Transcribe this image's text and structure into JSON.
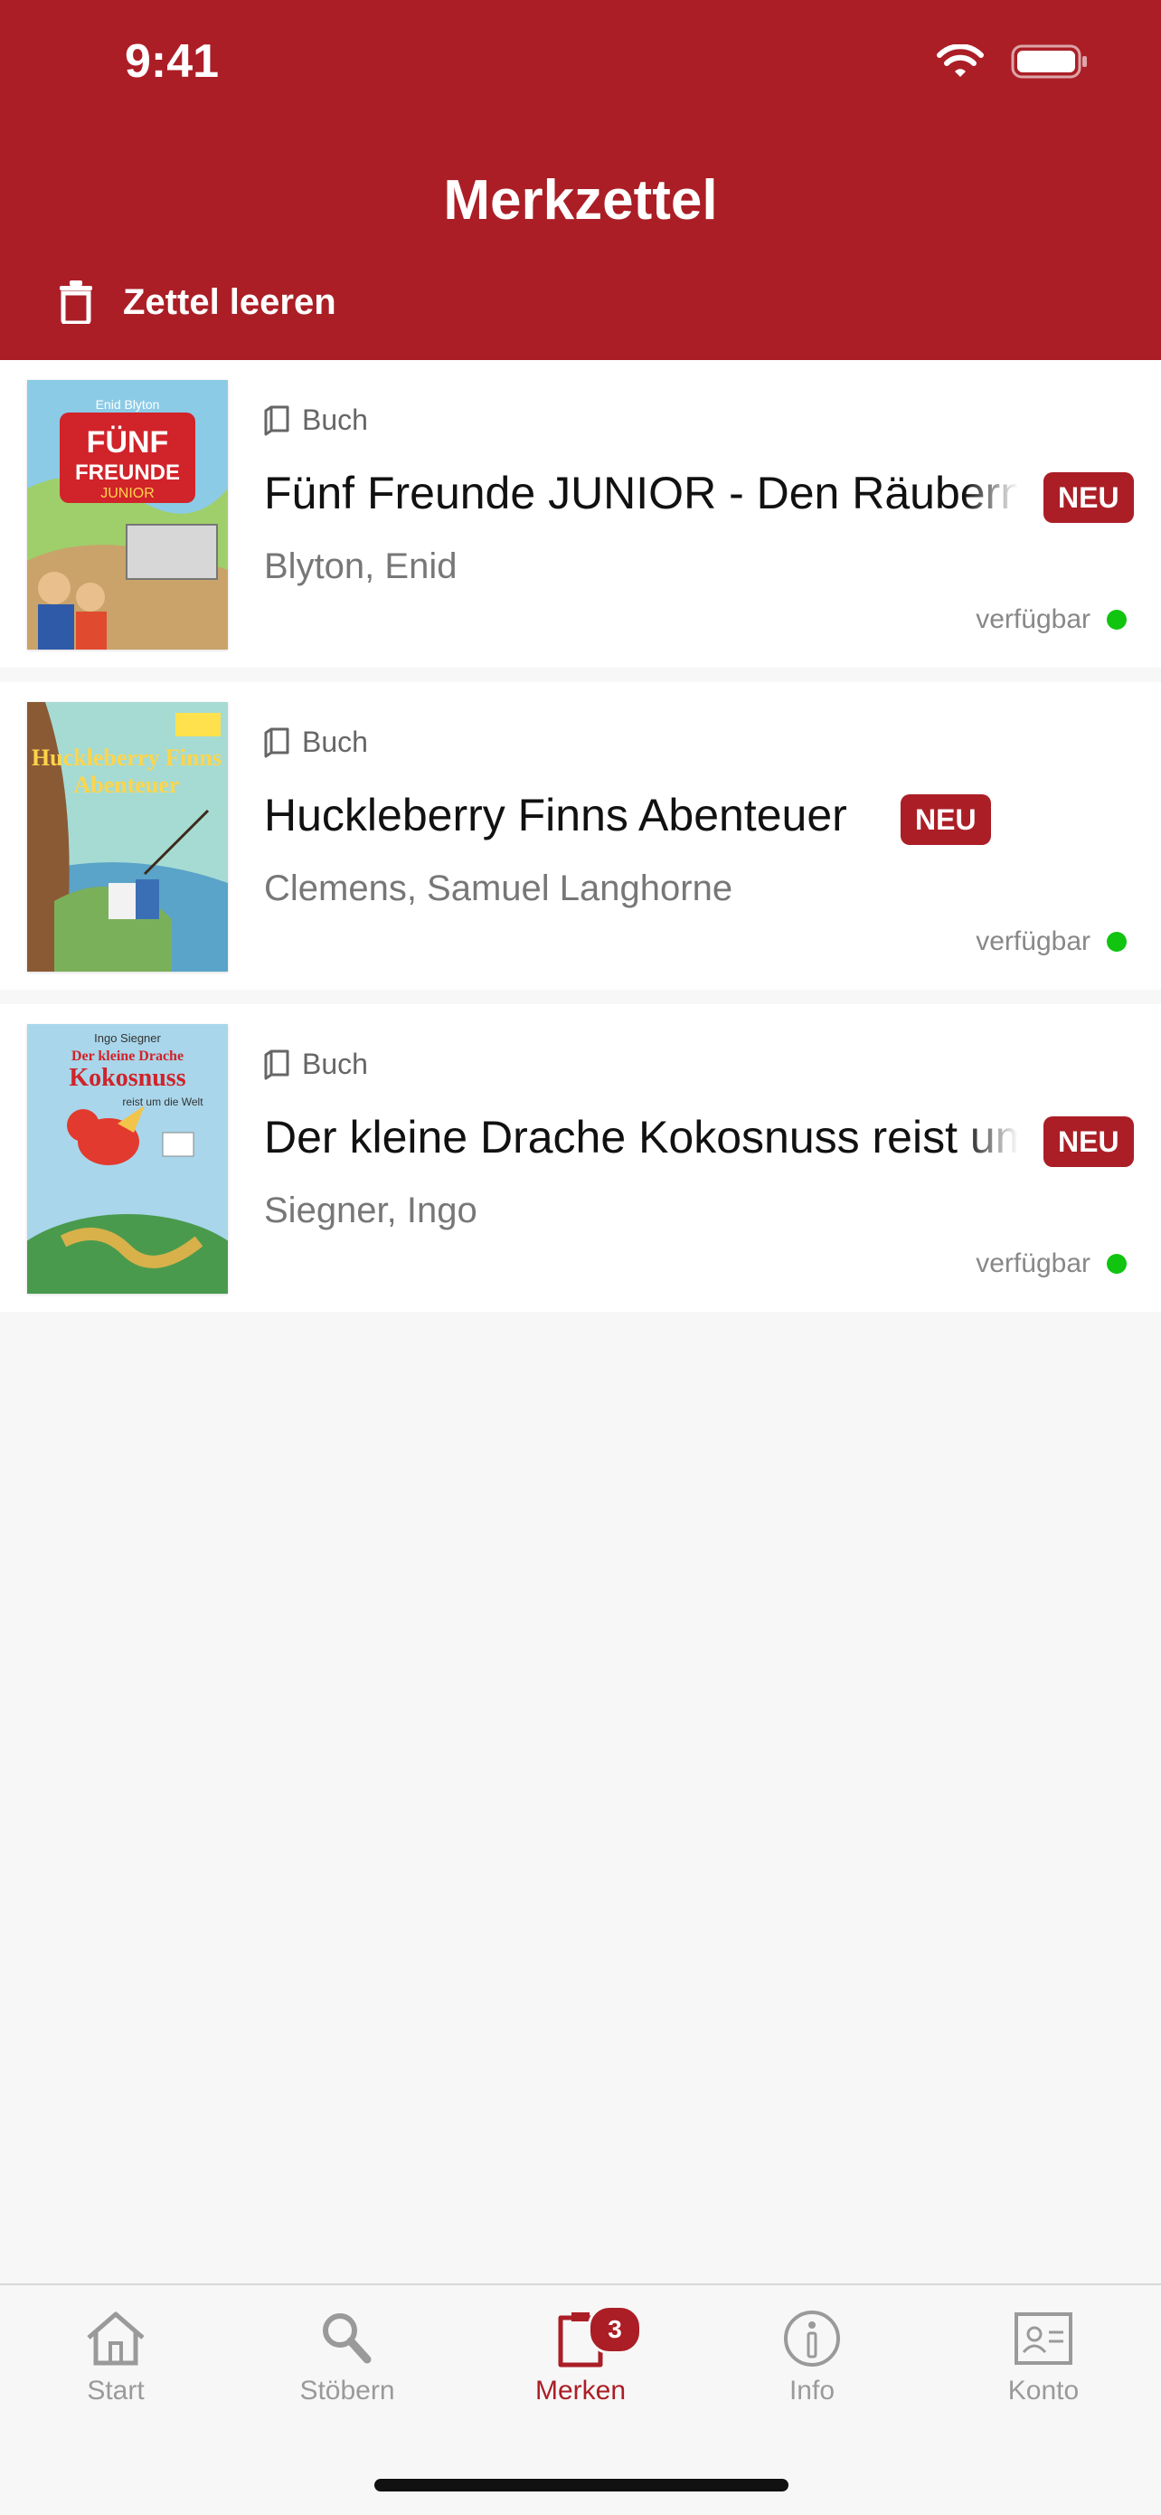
{
  "status_bar": {
    "time": "9:41"
  },
  "header": {
    "title": "Merkzettel",
    "clear_label": "Zettel leeren"
  },
  "items": [
    {
      "type": "Buch",
      "title": "Fünf Freunde JUNIOR - Den Räubern auf der Spur",
      "badge": "NEU",
      "author": "Blyton, Enid",
      "availability": "verfügbar",
      "cover": {
        "brand": "Enid Blyton",
        "main": "FÜNF FREUNDE",
        "sub": "JUNIOR",
        "colors": {
          "bg": "#7cc3e0",
          "banner": "#d1232a"
        }
      }
    },
    {
      "type": "Buch",
      "title": "Huckleberry Finns Abenteuer",
      "badge": "NEU",
      "author": "Clemens, Samuel Langhorne",
      "availability": "verfügbar",
      "cover": {
        "main": "Huckleberry Finns Abenteuer",
        "colors": {
          "bg": "#8fd0c8"
        }
      }
    },
    {
      "type": "Buch",
      "title": "Der kleine Drache Kokosnuss reist um die Welt",
      "badge": "NEU",
      "author": "Siegner, Ingo",
      "availability": "verfügbar",
      "cover": {
        "brand": "Ingo Siegner",
        "main": "Der kleine Drache Kokosnuss",
        "sub": "reist um die Welt",
        "colors": {
          "bg": "#a9d6ea"
        }
      }
    }
  ],
  "tabbar": {
    "tabs": [
      {
        "label": "Start",
        "icon": "house-icon"
      },
      {
        "label": "Stöbern",
        "icon": "magnifier-icon"
      },
      {
        "label": "Merken",
        "icon": "bookmark-list-icon",
        "badge": "3",
        "active": true
      },
      {
        "label": "Info",
        "icon": "info-icon"
      },
      {
        "label": "Konto",
        "icon": "account-card-icon"
      }
    ]
  },
  "colors": {
    "brand": "#ab1e26",
    "available": "#10c410"
  }
}
